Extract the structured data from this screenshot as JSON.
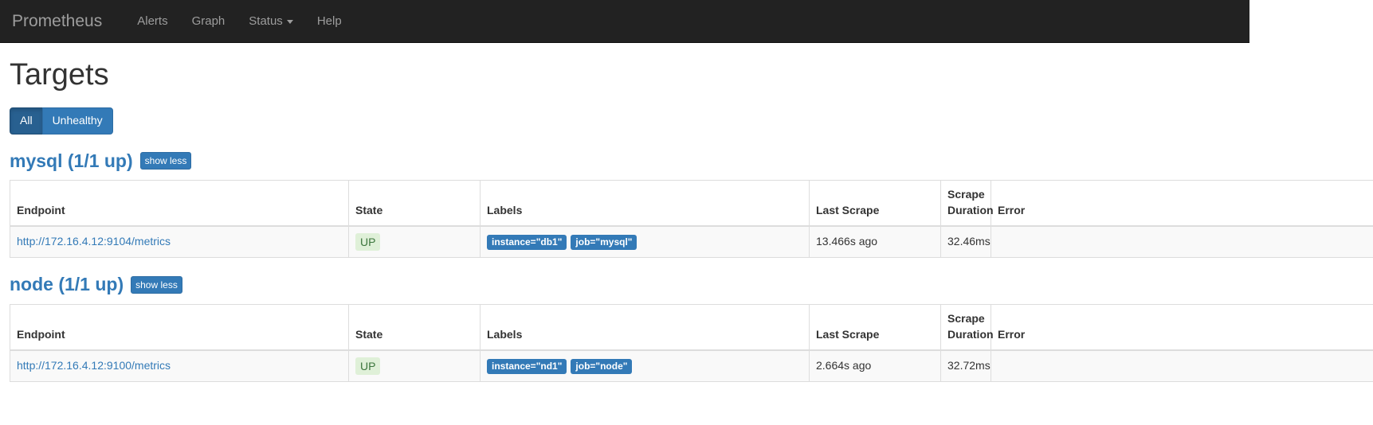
{
  "navbar": {
    "brand": "Prometheus",
    "items": [
      {
        "label": "Alerts",
        "icon": "",
        "has_caret": false
      },
      {
        "label": "Graph",
        "icon": "",
        "has_caret": false
      },
      {
        "label": "Status",
        "icon": "chevron-down-icon",
        "has_caret": true
      },
      {
        "label": "Help",
        "icon": "",
        "has_caret": false
      }
    ]
  },
  "page": {
    "title": "Targets"
  },
  "filters": {
    "all_label": "All",
    "unhealthy_label": "Unhealthy",
    "active": "All"
  },
  "table_headers": {
    "endpoint": "Endpoint",
    "state": "State",
    "labels": "Labels",
    "last_scrape": "Last Scrape",
    "scrape_duration": "Scrape Duration",
    "error": "Error"
  },
  "colors": {
    "navbar_bg": "#222222",
    "brand_text": "#9d9d9d",
    "link_blue": "#337ab7",
    "active_blue": "#286090",
    "up_bg": "#dff0d8",
    "up_text": "#3c763d",
    "label_pill_bg": "#337ab7"
  },
  "jobs": [
    {
      "name": "mysql",
      "heading": "mysql (1/1 up)",
      "toggle_label": "show less",
      "targets": [
        {
          "endpoint": "http://172.16.4.12:9104/metrics",
          "state": "UP",
          "labels": [
            "instance=\"db1\"",
            "job=\"mysql\""
          ],
          "last_scrape": "13.466s ago",
          "scrape_duration": "32.46ms",
          "error": ""
        }
      ]
    },
    {
      "name": "node",
      "heading": "node (1/1 up)",
      "toggle_label": "show less",
      "targets": [
        {
          "endpoint": "http://172.16.4.12:9100/metrics",
          "state": "UP",
          "labels": [
            "instance=\"nd1\"",
            "job=\"node\""
          ],
          "last_scrape": "2.664s ago",
          "scrape_duration": "32.72ms",
          "error": ""
        }
      ]
    }
  ]
}
